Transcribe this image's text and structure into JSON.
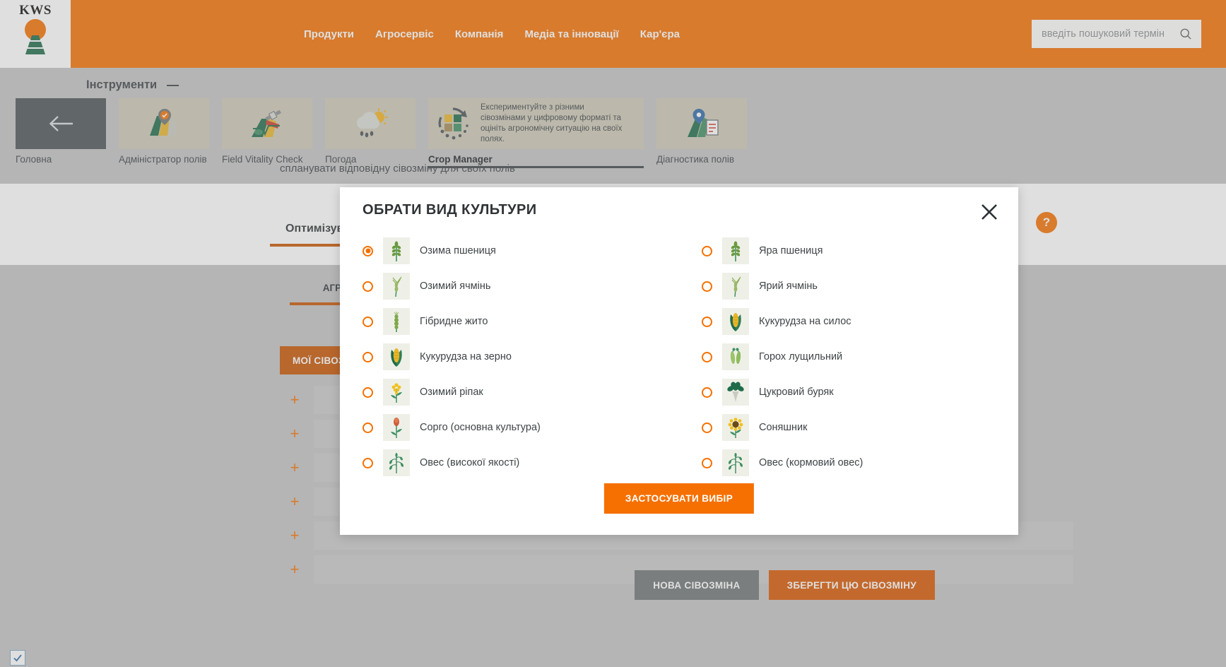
{
  "header": {
    "logo": {
      "text": "KWS",
      "alt": "kws-logo"
    },
    "nav": [
      {
        "label": "Продукти"
      },
      {
        "label": "Агросервіс"
      },
      {
        "label": "Компанія"
      },
      {
        "label": "Медіа та інновації"
      },
      {
        "label": "Кар'єра"
      }
    ],
    "search": {
      "placeholder": "введіть пошуковий термін",
      "value": "",
      "icon": "search-icon"
    },
    "colors": {
      "brand_orange": "#f57000",
      "logo_green": "#1f6b4a"
    }
  },
  "toolsbar": {
    "title": "Інструменти",
    "tiles": [
      {
        "label": "Головна",
        "icon": "back-arrow-icon",
        "active": false
      },
      {
        "label": "Адміністратор полів",
        "icon": "field-map-pin-icon",
        "active": false
      },
      {
        "label": "Field Vitality Check",
        "icon": "satellite-field-icon",
        "active": false
      },
      {
        "label": "Погода",
        "icon": "weather-rain-sun-icon",
        "active": false
      },
      {
        "label": "Crop Manager",
        "icon": "crop-rotation-icon",
        "active": true,
        "tooltip": "Експериментуйте з різними сівозмінами у цифровому форматі та оцініть агрономічну ситуацію на своїх полях."
      },
      {
        "label": "Діагностика полів",
        "icon": "field-diagnostics-icon",
        "active": false
      }
    ]
  },
  "background": {
    "intro_text": "спланувати відповідну сівозміну для своїх полів",
    "tabs": [
      {
        "label": "Оптимізув"
      }
    ],
    "help_label": "?",
    "subtab": "АГРОНОМІЧНА ОЦІНКА",
    "my_rotations_button": "МОЇ СІВОЗМІНИ",
    "row_add_icon": "+",
    "rows": [
      {
        "id": "row-1"
      },
      {
        "id": "row-2"
      },
      {
        "id": "row-3"
      },
      {
        "id": "row-4"
      },
      {
        "id": "row-5"
      },
      {
        "id": "row-6"
      }
    ],
    "footer_buttons": [
      {
        "label": "НОВА СІВОЗМІНА",
        "style": "grey"
      },
      {
        "label": "ЗБЕРЕГТИ ЦЮ СІВОЗМІНУ",
        "style": "orange"
      }
    ]
  },
  "modal": {
    "title": "ОБРАТИ ВИД КУЛЬТУРИ",
    "close_icon": "close-icon",
    "apply_label": "ЗАСТОСУВАТИ ВИБІР",
    "crops_left": [
      {
        "label": "Озима пшениця",
        "icon": "wheat-icon",
        "selected": true
      },
      {
        "label": "Озимий ячмінь",
        "icon": "barley-icon",
        "selected": false
      },
      {
        "label": "Гібридне жито",
        "icon": "rye-icon",
        "selected": false
      },
      {
        "label": "Кукурудза на зерно",
        "icon": "maize-grain-icon",
        "selected": false
      },
      {
        "label": "Озимий ріпак",
        "icon": "rapeseed-icon",
        "selected": false
      },
      {
        "label": "Сорго (основна культура)",
        "icon": "sorghum-icon",
        "selected": false
      },
      {
        "label": "Овес (високої якості)",
        "icon": "oat-icon",
        "selected": false
      }
    ],
    "crops_right": [
      {
        "label": "Яра пшениця",
        "icon": "wheat-icon",
        "selected": false
      },
      {
        "label": "Ярий ячмінь",
        "icon": "barley-icon",
        "selected": false
      },
      {
        "label": "Кукурудза на силос",
        "icon": "maize-silage-icon",
        "selected": false
      },
      {
        "label": "Горох лущильний",
        "icon": "pea-icon",
        "selected": false
      },
      {
        "label": "Цукровий буряк",
        "icon": "sugarbeet-icon",
        "selected": false
      },
      {
        "label": "Соняшник",
        "icon": "sunflower-icon",
        "selected": false
      },
      {
        "label": "Овес (кормовий овес)",
        "icon": "oat-icon",
        "selected": false
      }
    ]
  }
}
